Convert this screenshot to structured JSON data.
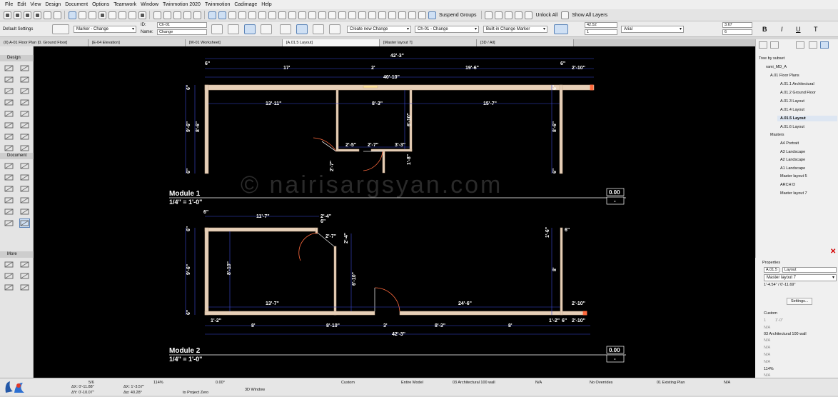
{
  "menu": [
    "File",
    "Edit",
    "View",
    "Design",
    "Document",
    "Options",
    "Teamwork",
    "Window",
    "Twinmotion 2020",
    "Twinmotion",
    "Cadimage",
    "Help"
  ],
  "toolbar": {
    "suspend_groups": "Suspend Groups",
    "unlock_all": "Unlock All",
    "show_all_layers": "Show All Layers"
  },
  "infobox": {
    "default_settings": "Default Settings",
    "marker": "Marker - Change",
    "id_label": "ID:",
    "id_value": "Ch-01",
    "name_label": "Name:",
    "name_value": "Change",
    "create_new": "Create new Change",
    "change_ref": "Ch-01 - Change",
    "builtin_marker": "Built-in Change Marker",
    "val1": "42.52",
    "val2": "1",
    "font": "Arial",
    "val3": "3.67",
    "val4": "6"
  },
  "tabs": [
    "(0) A-01 Floor Plan [0. Ground Floor]",
    "[E-04 Elevation]",
    "[W-01 Worksheet]",
    "[A.01.5 Layout]",
    "[Master layout 7]",
    "[3D / All]"
  ],
  "toolbox": {
    "design": "Design",
    "document": "Document",
    "more": "More"
  },
  "canvas": {
    "watermark": "© nairisargsyan.com",
    "module1": {
      "title": "Module 1",
      "scale": "1/4\"   =   1'-0\"",
      "num": "0.00",
      "dash": "-"
    },
    "module2": {
      "title": "Module 2",
      "scale": "1/4\"   =   1'-0\"",
      "num": "0.00",
      "dash": "-"
    },
    "dims1": [
      "42'-3\"",
      "6\"",
      "6\"",
      "17'",
      "2'",
      "19'-6\"",
      "2'-10\"",
      "40'-10\"",
      "13'-11\"",
      "8'-3\"",
      "15'-7\"",
      "6'-10\"",
      "2'-5\"",
      "2'-7\"",
      "3'-3\"",
      "1'-8\"",
      "2'-7\"",
      "9'-6\"",
      "8'-6\"",
      "8'-6\"",
      "6\"",
      "6\"",
      "6\"",
      "6\""
    ],
    "dims2": [
      "6\"",
      "11'-7\"",
      "2'-4\"",
      "6\"",
      "2'-7\"",
      "2'-4\"",
      "8'-10\"",
      "9'-6\"",
      "6'-10\"",
      "13'-7\"",
      "24'-6\"",
      "1'-2\"",
      "8'",
      "8'-10\"",
      "3'",
      "8'-3\"",
      "8'",
      "1'-2\"",
      "6\"",
      "2'-10\"",
      "42'-3\"",
      "8'",
      "1'-6\"",
      "2'-10\"",
      "6\"",
      "6\"",
      "6\""
    ]
  },
  "navigator": {
    "header": "Tree by subset",
    "root": "rami_MD_A",
    "group": "A.01 Floor Plans",
    "items": [
      "A.01.1 Architectural",
      "A.01.2 Ground Floor",
      "A.01.3 Layout",
      "A.01.4 Layout",
      "A.01.5 Layout",
      "A.01.6 Layout"
    ],
    "masters_label": "Masters",
    "masters": [
      "A4 Portrait",
      "A3 Landscape",
      "A2 Landscape",
      "A1 Landscape",
      "Master layout 5",
      "ARCH D",
      "Master layout 7"
    ]
  },
  "properties": {
    "header": "Properties",
    "id": "A.01.5",
    "name": "Layout",
    "master": "Master layout 7",
    "size": "1'-4.54\" / 0'-11.69\"",
    "settings": "Settings...",
    "custom": "Custom",
    "na": "N/A",
    "one": "1",
    "dash": "1'-0\"",
    "layer": "03 Architectural 100 wall",
    "zoom": "114%"
  },
  "status": {
    "page": "5/6",
    "zoom": "114%",
    "angle": "0.00°",
    "custom": "Custom",
    "entire_model": "Entire Model",
    "layer": "03 Architectural 100 wall",
    "na": "N/A",
    "no_overrides": "No Overrides",
    "existing_plan": "01 Existing Plan",
    "coords": [
      "ΔX: 0'-11.88\"",
      "ΔY: 0'-10.07\"",
      "ΔX: 1'-3.57\"",
      "Δα: 40.28°"
    ],
    "to_project_zero": "to Project Zero",
    "window_3d": "3D Window"
  },
  "colors": {
    "wall": "#e6cfb8",
    "dim": "#3b4bd8",
    "bg": "#000000",
    "accent": "#cfe0f4"
  }
}
